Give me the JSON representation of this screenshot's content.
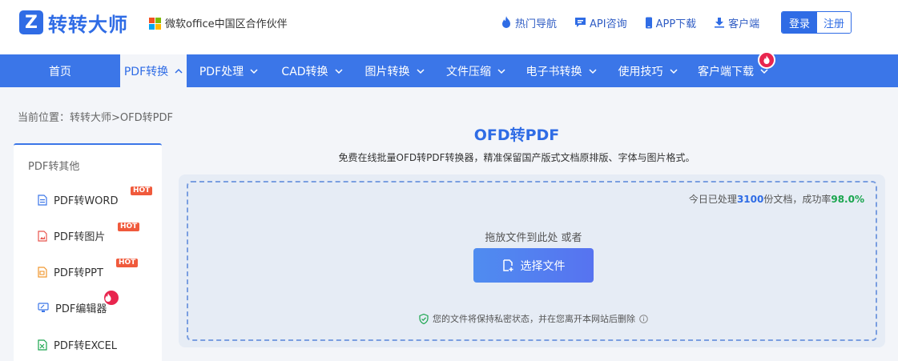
{
  "header": {
    "logo_glyph": "Z",
    "logo_text": "转转大师",
    "partner_text": "微软office中国区合作伙伴",
    "links": [
      {
        "label": "热门导航",
        "icon": "flame-icon"
      },
      {
        "label": "API咨询",
        "icon": "chat-icon"
      },
      {
        "label": "APP下载",
        "icon": "phone-icon"
      },
      {
        "label": "客户端",
        "icon": "download-icon"
      }
    ],
    "login_label": "登录",
    "register_label": "注册"
  },
  "nav": {
    "items": [
      {
        "label": "首页",
        "has_chevron": false,
        "active": false
      },
      {
        "label": "PDF转换",
        "has_chevron": true,
        "active": true
      },
      {
        "label": "PDF处理",
        "has_chevron": true,
        "active": false
      },
      {
        "label": "CAD转换",
        "has_chevron": true,
        "active": false
      },
      {
        "label": "图片转换",
        "has_chevron": true,
        "active": false
      },
      {
        "label": "文件压缩",
        "has_chevron": true,
        "active": false
      },
      {
        "label": "电子书转换",
        "has_chevron": true,
        "active": false
      },
      {
        "label": "使用技巧",
        "has_chevron": true,
        "active": false
      },
      {
        "label": "客户端下载",
        "has_chevron": true,
        "active": false,
        "hot": true
      }
    ]
  },
  "breadcrumb": {
    "prefix": "当前位置：",
    "path": "转转大师>OFD转PDF"
  },
  "sidebar": {
    "title": "PDF转其他",
    "items": [
      {
        "label": "PDF转WORD",
        "icon": "word-file-icon",
        "badge": "HOT"
      },
      {
        "label": "PDF转图片",
        "icon": "image-file-icon",
        "badge": "HOT"
      },
      {
        "label": "PDF转PPT",
        "icon": "ppt-file-icon",
        "badge": "HOT"
      },
      {
        "label": "PDF编辑器",
        "icon": "editor-icon",
        "badge": "fire"
      },
      {
        "label": "PDF转EXCEL",
        "icon": "excel-file-icon",
        "badge": ""
      }
    ]
  },
  "main": {
    "title": "OFD转PDF",
    "subtitle": "免费在线批量OFD转PDF转换器，精准保留国产版式文档原排版、字体与图片格式。",
    "stats_prefix": "今日已处理",
    "stats_count": "3100",
    "stats_middle": "份文档，成功率",
    "stats_rate": "98.0%",
    "drop_hint": "拖放文件到此处 或者",
    "choose_label": "选择文件",
    "privacy_text": "您的文件将保持私密状态，并在您离开本网站后删除"
  },
  "colors": {
    "brand": "#2f6ce5",
    "nav_bg": "#3b76e8",
    "hot_red": "#e8254e",
    "success_green": "#1aa54e"
  }
}
